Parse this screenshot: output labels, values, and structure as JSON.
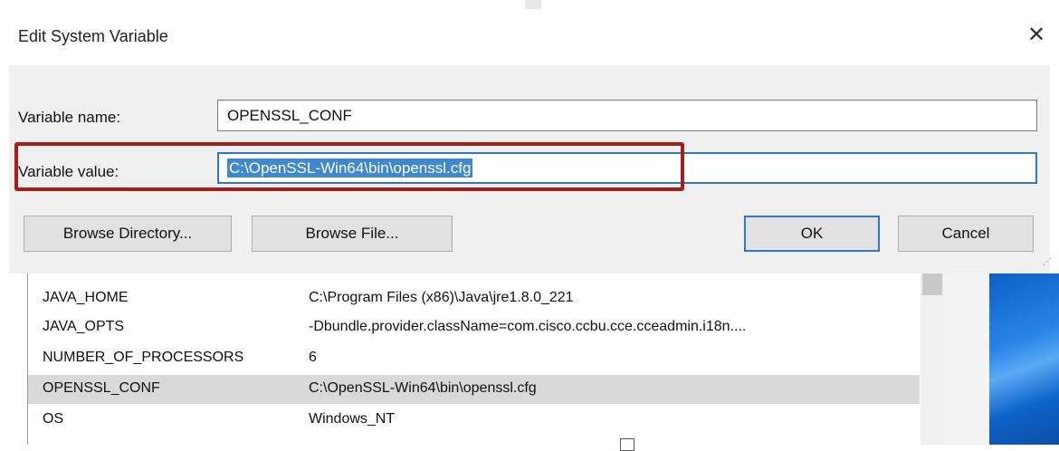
{
  "dialog": {
    "title": "Edit System Variable",
    "close_label": "✕",
    "variable_name_label": "Variable name:",
    "variable_name_value": "OPENSSL_CONF",
    "variable_value_label": "Variable value:",
    "variable_value_value": "C:\\OpenSSL-Win64\\bin\\openssl.cfg",
    "buttons": {
      "browse_directory": "Browse Directory...",
      "browse_file": "Browse File...",
      "ok": "OK",
      "cancel": "Cancel"
    }
  },
  "variables_list": {
    "rows": [
      {
        "name": "JAVA_HOME",
        "value": "C:\\Program Files (x86)\\Java\\jre1.8.0_221"
      },
      {
        "name": "JAVA_OPTS",
        "value": "-Dbundle.provider.className=com.cisco.ccbu.cce.cceadmin.i18n...."
      },
      {
        "name": "NUMBER_OF_PROCESSORS",
        "value": "6"
      },
      {
        "name": "OPENSSL_CONF",
        "value": "C:\\OpenSSL-Win64\\bin\\openssl.cfg"
      },
      {
        "name": "OS",
        "value": "Windows_NT"
      }
    ],
    "selected_row": "OPENSSL_CONF"
  },
  "colors": {
    "highlight_frame": "#a81c1c",
    "selection": "#3f88cf",
    "focus_border": "#2f78c8"
  }
}
